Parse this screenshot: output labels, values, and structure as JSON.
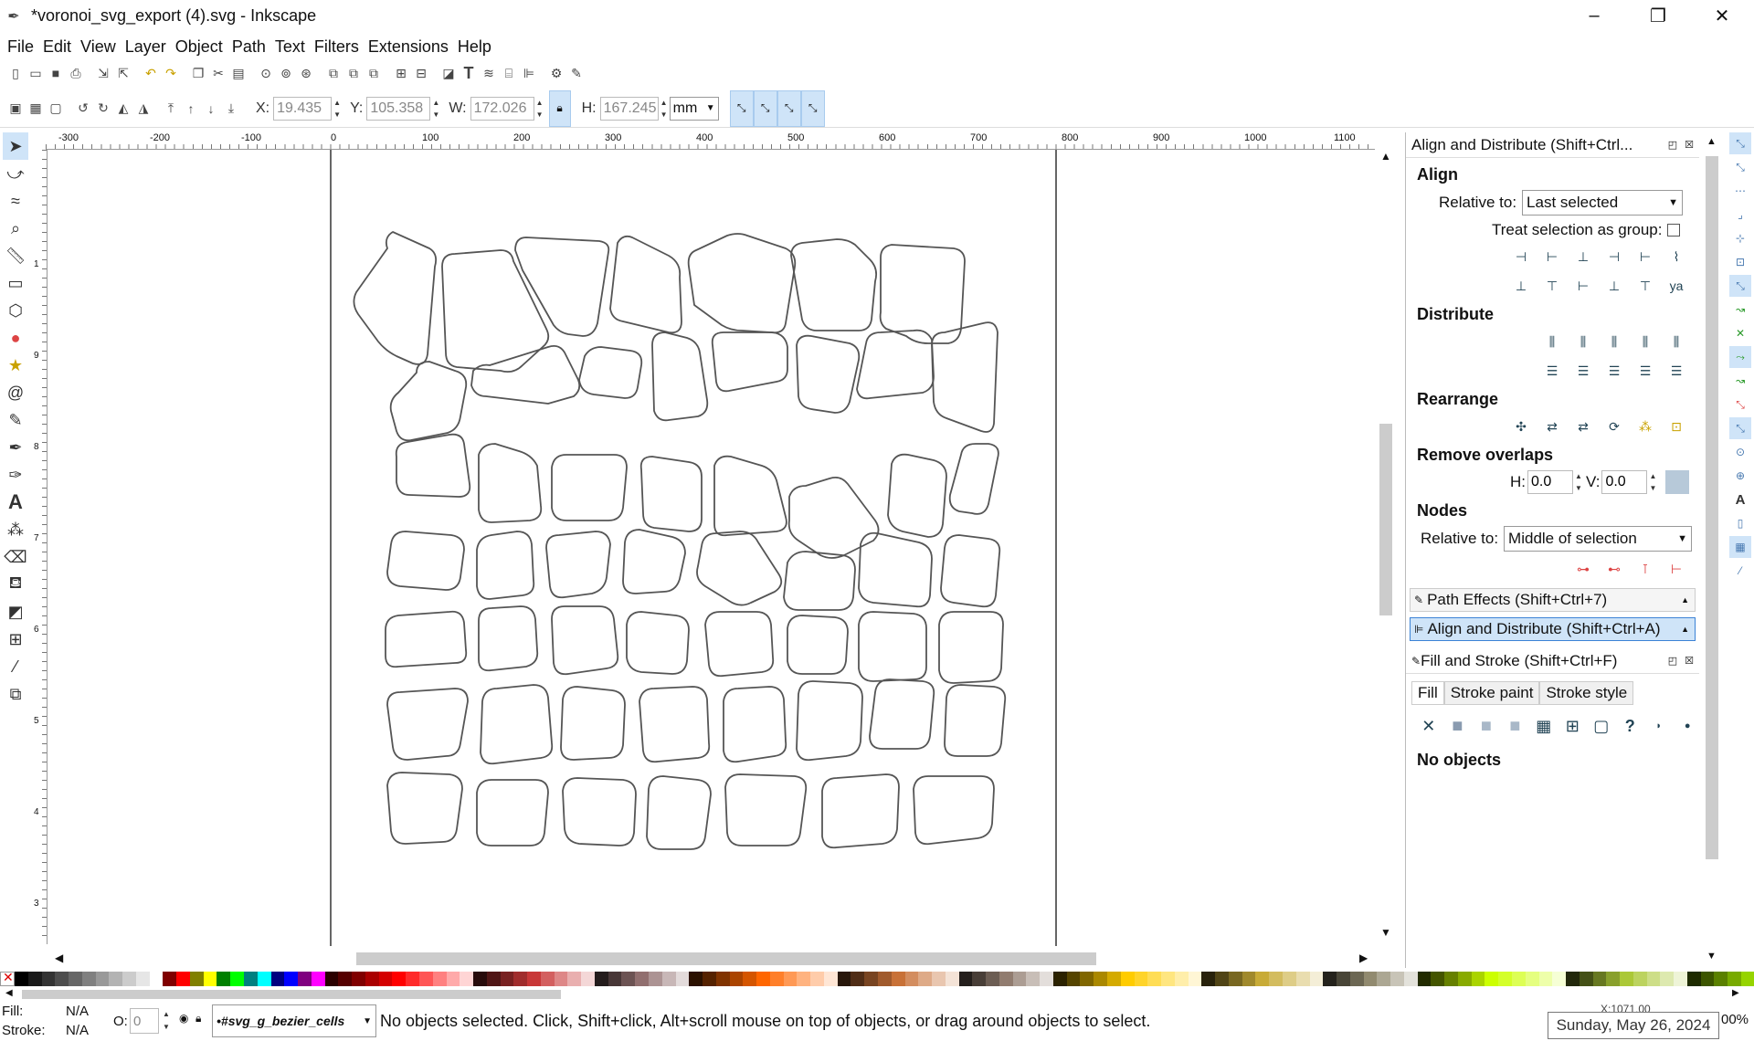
{
  "window": {
    "title": "*voronoi_svg_export (4).svg - Inkscape",
    "controls": [
      "–",
      "❐",
      "✕"
    ]
  },
  "menu": [
    "File",
    "Edit",
    "View",
    "Layer",
    "Object",
    "Path",
    "Text",
    "Filters",
    "Extensions",
    "Help"
  ],
  "controls": {
    "x_label": "X:",
    "x": "19.435",
    "y_label": "Y:",
    "y": "105.358",
    "w_label": "W:",
    "w": "172.026",
    "h_label": "H:",
    "h": "167.245",
    "unit": "mm"
  },
  "ruler": {
    "h_ticks": [
      "-300",
      "-200",
      "-100",
      "0",
      "100",
      "200",
      "300",
      "400",
      "500",
      "600",
      "700",
      "800",
      "900",
      "1000",
      "1100"
    ],
    "v_ticks": [
      "1",
      "0",
      "0",
      "0",
      "9",
      "0",
      "0",
      "8",
      "0",
      "0",
      "7",
      "0",
      "0",
      "6",
      "0",
      "0",
      "5",
      "0",
      "0",
      "4",
      "0",
      "0",
      "3",
      "0",
      "0"
    ]
  },
  "panel": {
    "align_distribute_title": "Align and Distribute (Shift+Ctrl...",
    "align_heading": "Align",
    "relative_to_label": "Relative to:",
    "relative_to_value": "Last selected",
    "treat_group_label": "Treat selection as group:",
    "distribute_heading": "Distribute",
    "rearrange_heading": "Rearrange",
    "remove_overlaps_heading": "Remove overlaps",
    "h_label": "H:",
    "h_value": "0.0",
    "v_label": "V:",
    "v_value": "0.0",
    "nodes_heading": "Nodes",
    "nodes_relative_label": "Relative to:",
    "nodes_relative_value": "Middle of selection",
    "path_effects_tab": "Path Effects  (Shift+Ctrl+7)",
    "align_tab": "Align and Distribute (Shift+Ctrl+A)",
    "fill_stroke_title": "Fill and Stroke (Shift+Ctrl+F)",
    "fill_tab": "Fill",
    "stroke_paint_tab": "Stroke paint",
    "stroke_style_tab": "Stroke style",
    "no_objects": "No objects"
  },
  "status": {
    "fill_label": "Fill:",
    "fill_value": "N/A",
    "stroke_label": "Stroke:",
    "stroke_value": "N/A",
    "opacity_label": "O:",
    "opacity_value": "0",
    "layer": "•#svg_g_bezier_cells",
    "message": "No objects selected. Click, Shift+click, Alt+scroll mouse on top of objects, or drag around objects to select.",
    "coords": "X:1071.00",
    "zoom": "00%",
    "date_tooltip": "Sunday, May 26, 2024"
  },
  "colors": {
    "accent": "#cfe4f8",
    "cell_stroke": "#555555",
    "page_border": "#333333"
  }
}
